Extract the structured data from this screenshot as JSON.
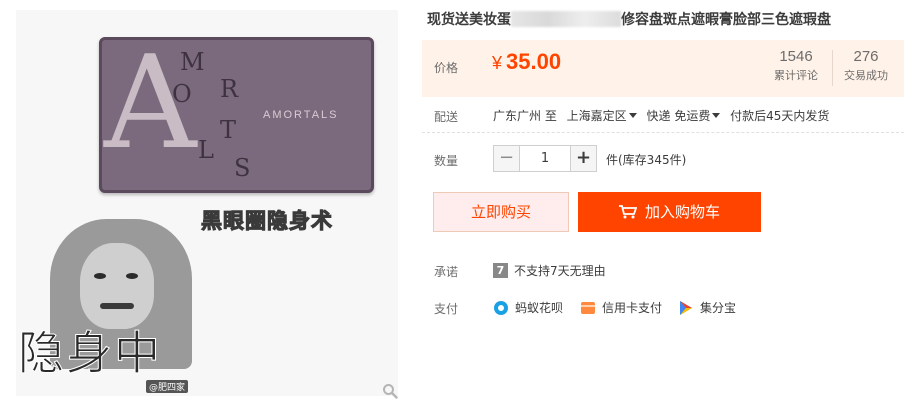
{
  "product": {
    "title_start": "现货送美妆蛋",
    "title_end": "修容盘斑点遮暇膏脸部三色遮瑕盘"
  },
  "image": {
    "logo_letters": [
      "A",
      "M",
      "O",
      "R",
      "T",
      "L",
      "S"
    ],
    "brand": "AMORTALS",
    "caption": "黑眼圈隐身术",
    "meme_text": "隐身中",
    "watermark": "@肥四家"
  },
  "price": {
    "label": "价格",
    "currency": "¥",
    "amount": "35.00",
    "reviews_count": "1546",
    "reviews_label": "累计评论",
    "sales_count": "276",
    "sales_label": "交易成功"
  },
  "delivery": {
    "label": "配送",
    "origin": "广东广州 至",
    "destination": "上海嘉定区",
    "shipping": "快递 免运费",
    "dispatch": "付款后45天内发货"
  },
  "quantity": {
    "label": "数量",
    "minus": "−",
    "value": "1",
    "plus": "+",
    "stock": "件(库存345件)"
  },
  "actions": {
    "buy_now": "立即购买",
    "add_to_cart": "加入购物车"
  },
  "promise": {
    "label": "承诺",
    "badge": "7",
    "text": "不支持7天无理由"
  },
  "payment": {
    "label": "支付",
    "methods": [
      "蚂蚁花呗",
      "信用卡支付",
      "集分宝"
    ]
  },
  "colors": {
    "accent": "#ff4400",
    "price_bg": "#fff2e8",
    "palette": "#7b6a7d"
  }
}
